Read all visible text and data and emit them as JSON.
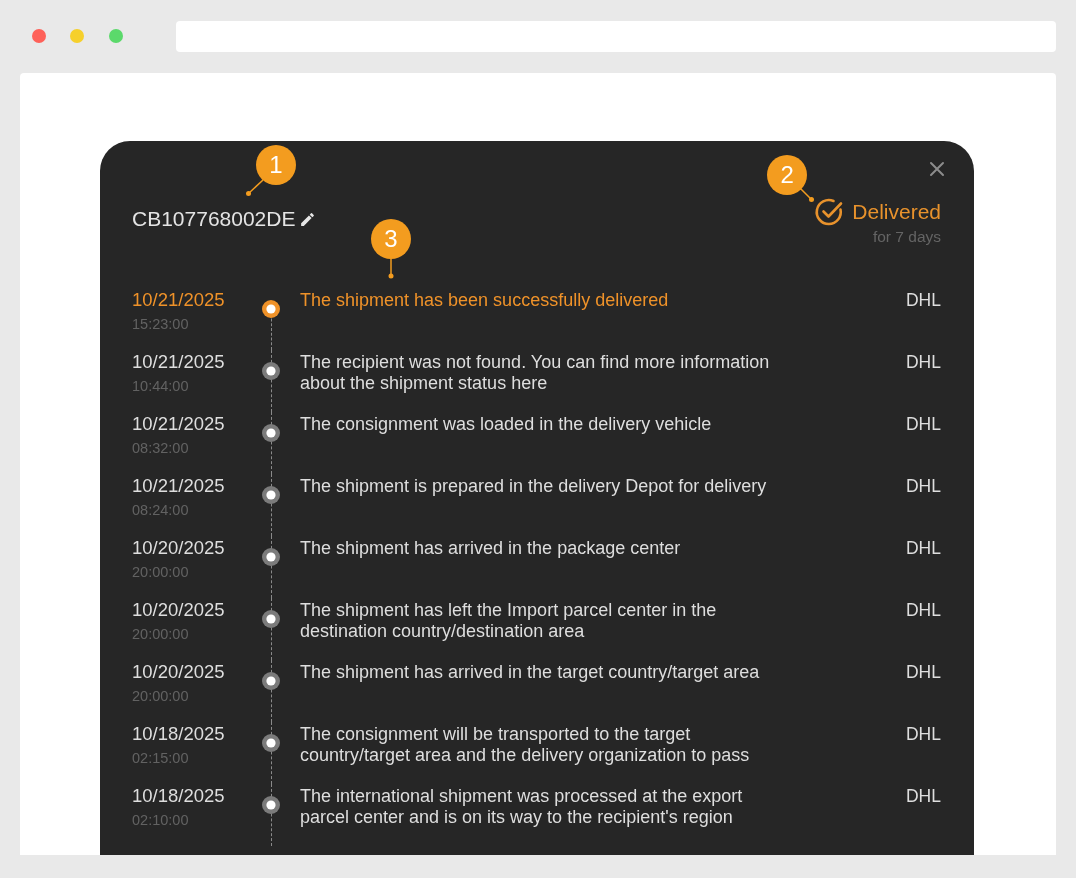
{
  "shipment": {
    "tracking_number": {
      "value": "CB107768002DE",
      "callout": "1"
    },
    "status": {
      "label": "Delivered",
      "duration": "for 7 days",
      "callout": "2"
    },
    "events": [
      {
        "date": "10/21/2025",
        "time": "15:23:00",
        "description": "The shipment has been successfully delivered",
        "carrier": "DHL",
        "current": true,
        "callout": "3"
      },
      {
        "date": "10/21/2025",
        "time": "10:44:00",
        "description": "The recipient was not found. You can find more information about the shipment status here",
        "carrier": "DHL",
        "current": false
      },
      {
        "date": "10/21/2025",
        "time": "08:32:00",
        "description": "The consignment was loaded in the delivery vehicle",
        "carrier": "DHL",
        "current": false
      },
      {
        "date": "10/21/2025",
        "time": "08:24:00",
        "description": "The shipment is prepared in the delivery Depot for delivery",
        "carrier": "DHL",
        "current": false
      },
      {
        "date": "10/20/2025",
        "time": "20:00:00",
        "description": "The shipment has arrived in the package center",
        "carrier": "DHL",
        "current": false
      },
      {
        "date": "10/20/2025",
        "time": "20:00:00",
        "description": "The shipment has left the Import parcel center in the destination country/destination area",
        "carrier": "DHL",
        "current": false
      },
      {
        "date": "10/20/2025",
        "time": "20:00:00",
        "description": "The shipment has arrived in the target country/target area",
        "carrier": "DHL",
        "current": false
      },
      {
        "date": "10/18/2025",
        "time": "02:15:00",
        "description": "The consignment will be transported to the target country/target area and the delivery organization to pass",
        "carrier": "DHL",
        "current": false
      },
      {
        "date": "10/18/2025",
        "time": "02:10:00",
        "description": "The international shipment was processed at the export parcel center and is on its way to the recipient's region",
        "carrier": "DHL",
        "current": false
      }
    ]
  }
}
